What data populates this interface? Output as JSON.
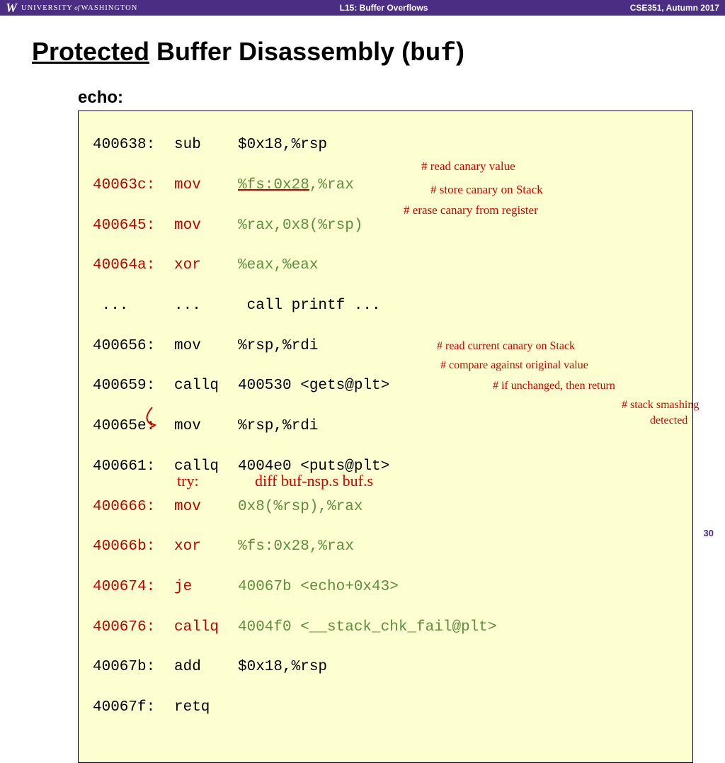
{
  "header": {
    "university_prefix": "UNIVERSITY",
    "university_of": "of",
    "university_name": "WASHINGTON",
    "center": "L15:  Buffer Overflows",
    "right": "CSE351, Autumn 2017"
  },
  "title": {
    "part1": "Protected",
    "part2": " Buffer Disassembly (",
    "mono": "buf",
    "part3": ")"
  },
  "subtitle": "echo:",
  "code": [
    {
      "addr": "400638:",
      "instr": "sub",
      "args": "$0x18,%rsp",
      "red": false
    },
    {
      "addr": "40063c:",
      "instr": "mov",
      "args_pre": "",
      "args_ul": "%fs:0x28",
      "args_post": ",%rax",
      "red": true,
      "green_args": true
    },
    {
      "addr": "400645:",
      "instr": "mov",
      "args": "%rax,0x8(%rsp)",
      "red": true,
      "green_args": true
    },
    {
      "addr": "40064a:",
      "instr": "xor",
      "args": "%eax,%eax",
      "red": true,
      "green_args": true
    },
    {
      "addr": " ...",
      "instr": "...",
      "args": "call printf ...",
      "plain": true
    },
    {
      "addr": "400656:",
      "instr": "mov",
      "args": "%rsp,%rdi",
      "red": false
    },
    {
      "addr": "400659:",
      "instr": "callq",
      "args": "400530 <gets@plt>",
      "red": false
    },
    {
      "addr": "40065e:",
      "instr": "mov",
      "args": "%rsp,%rdi",
      "red": false
    },
    {
      "addr": "400661:",
      "instr": "callq",
      "args": "4004e0 <puts@plt>",
      "red": false
    },
    {
      "addr": "400666:",
      "instr": "mov",
      "args": "0x8(%rsp),%rax",
      "red": true,
      "green_args": true
    },
    {
      "addr": "40066b:",
      "instr": "xor",
      "args": "%fs:0x28,%rax",
      "red": true,
      "green_args": true
    },
    {
      "addr": "400674:",
      "instr": "je",
      "args": "40067b <echo+0x43>",
      "red": true,
      "green_args": true
    },
    {
      "addr": "400676:",
      "instr": "callq",
      "args": "4004f0 <__stack_chk_fail@plt>",
      "red": true,
      "green_args": true
    },
    {
      "addr": "40067b:",
      "instr": "add",
      "args": "$0x18,%rsp",
      "red": false
    },
    {
      "addr": "40067f:",
      "instr": "retq",
      "args": "",
      "red": false
    }
  ],
  "annotations": {
    "a1": "# read canary value",
    "a2": "# store canary on Stack",
    "a3": "# erase canary from register",
    "a4": "# read current canary on Stack",
    "a5": "# compare against original value",
    "a6": "# if unchanged, then return",
    "a7": "# stack smashing",
    "a7b": "detected"
  },
  "bottom": {
    "try": "try:",
    "cmd": "diff  buf-nsp.s  buf.s"
  },
  "page": "30"
}
